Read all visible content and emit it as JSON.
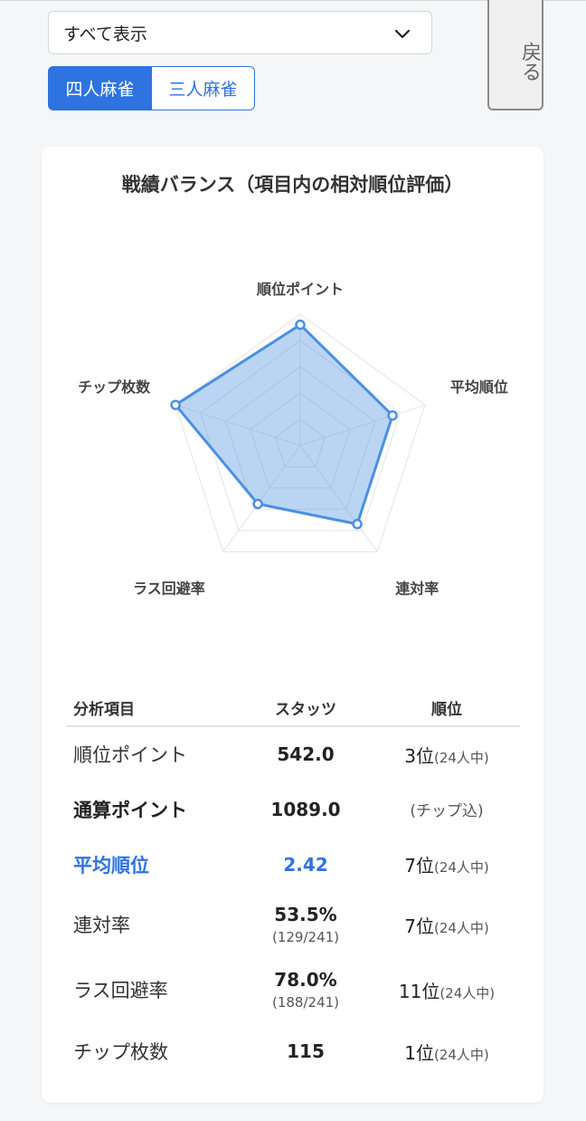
{
  "filter": {
    "selected": "すべて表示"
  },
  "back_label": "戻る",
  "tabs": [
    {
      "label": "四人麻雀",
      "active": true
    },
    {
      "label": "三人麻雀",
      "active": false
    }
  ],
  "card": {
    "title": "戦績バランス（項目内の相対順位評価）"
  },
  "chart_data": {
    "type": "radar",
    "axes": [
      "順位ポイント",
      "平均順位",
      "連対率",
      "ラス回避率",
      "チップ枚数"
    ],
    "values": [
      0.92,
      0.74,
      0.74,
      0.55,
      1.0
    ],
    "rmax": 1,
    "grid_levels": 5,
    "color": "#4a90e2"
  },
  "table": {
    "headers": {
      "item": "分析項目",
      "stats": "スタッツ",
      "rank": "順位"
    },
    "rows": [
      {
        "item": "順位ポイント",
        "value": "542.0",
        "rank": "3位",
        "rank_sub": "(24人中)",
        "style": "normal"
      },
      {
        "item": "通算ポイント",
        "value": "1089.0",
        "note": "(チップ込)",
        "style": "bold"
      },
      {
        "item": "平均順位",
        "value": "2.42",
        "rank": "7位",
        "rank_sub": "(24人中)",
        "style": "highlight"
      },
      {
        "item": "連対率",
        "value": "53.5%",
        "sub": "(129/241)",
        "rank": "7位",
        "rank_sub": "(24人中)",
        "style": "normal"
      },
      {
        "item": "ラス回避率",
        "value": "78.0%",
        "sub": "(188/241)",
        "rank": "11位",
        "rank_sub": "(24人中)",
        "style": "normal"
      },
      {
        "item": "チップ枚数",
        "value": "115",
        "rank": "1位",
        "rank_sub": "(24人中)",
        "style": "normal"
      }
    ]
  }
}
